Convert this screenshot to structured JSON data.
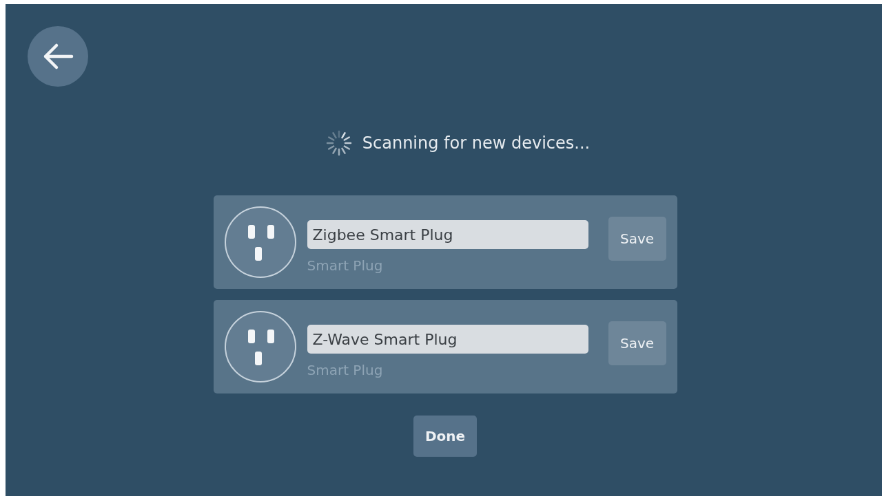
{
  "status": {
    "text": "Scanning for new devices..."
  },
  "devices": [
    {
      "name": "Zigbee Smart Plug",
      "type": "Smart Plug",
      "action": "Save"
    },
    {
      "name": "Z-Wave Smart Plug",
      "type": "Smart Plug",
      "action": "Save"
    }
  ],
  "done_button": "Done"
}
